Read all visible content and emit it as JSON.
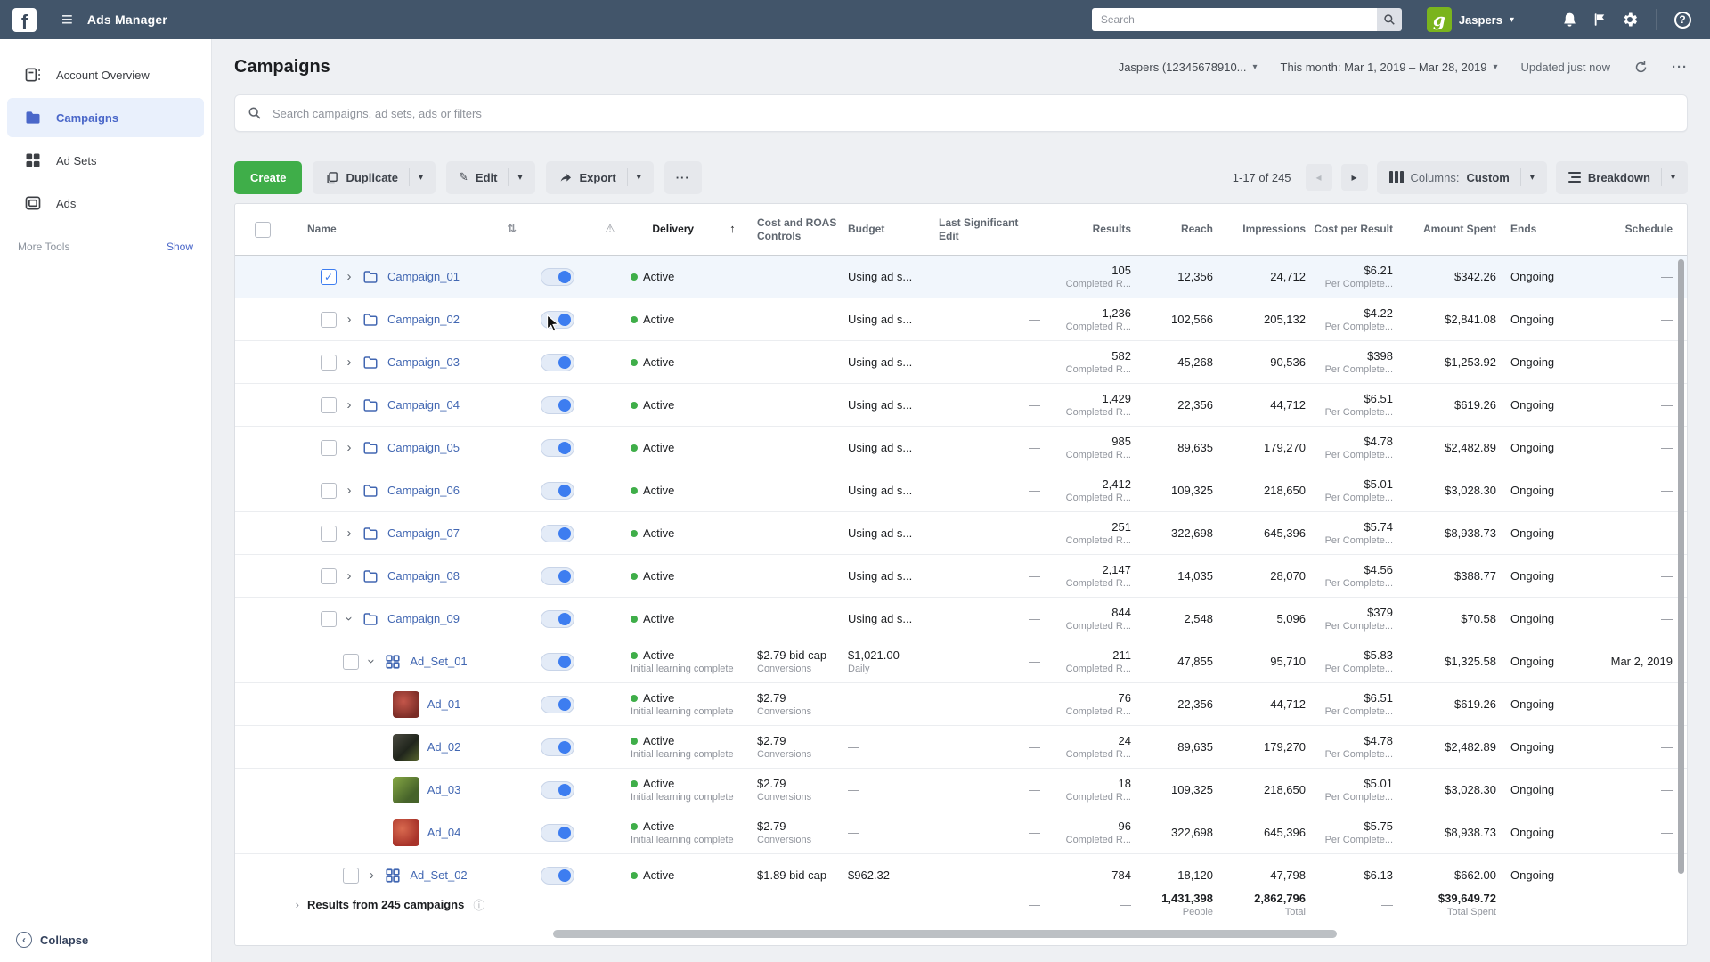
{
  "colors": {
    "topbar_bg": "#42556a",
    "accent_green": "#3fae49",
    "link_blue": "#4267b2",
    "sidebar_active_blue": "#4a67c9",
    "toggle_blue": "#3d7df0",
    "active_dot_green": "#3fae49"
  },
  "icons": {
    "facebook_letter": "f",
    "hamburger": "≡",
    "avatar_letter": "g",
    "caret": "▾",
    "question": "?",
    "sort": "⇅",
    "sort_asc": "↑",
    "warning": "⚠",
    "chevron": "›",
    "check": "✓",
    "ellipsis": "···",
    "prev": "◂",
    "next": "▸",
    "pencil": "✎",
    "info": "ⓘ",
    "collapse": "‹",
    "expander": "›"
  },
  "topbar": {
    "app_title": "Ads Manager",
    "search_placeholder": "Search",
    "user_name": "Jaspers"
  },
  "sidebar": {
    "items": [
      {
        "label": "Account Overview"
      },
      {
        "label": "Campaigns"
      },
      {
        "label": "Ad Sets"
      },
      {
        "label": "Ads"
      }
    ],
    "more_tools_label": "More Tools",
    "show_label": "Show",
    "collapse_label": "Collapse"
  },
  "header": {
    "page_title": "Campaigns",
    "account_selector": "Jaspers (12345678910...",
    "date_range": "This month: Mar 1, 2019 – Mar 28, 2019",
    "updated_label": "Updated just now"
  },
  "searchbar": {
    "placeholder": "Search campaigns, ad sets, ads or filters"
  },
  "toolbar": {
    "create_label": "Create",
    "duplicate_label": "Duplicate",
    "edit_label": "Edit",
    "export_label": "Export",
    "pagination": "1-17 of 245",
    "columns_label": "Columns:",
    "columns_value": "Custom",
    "breakdown_label": "Breakdown"
  },
  "table": {
    "headers": {
      "name": "Name",
      "delivery": "Delivery",
      "cost": "Cost and ROAS Controls",
      "budget": "Budget",
      "lse": "Last Significant Edit",
      "results": "Results",
      "reach": "Reach",
      "impressions": "Impressions",
      "cpr": "Cost per Result",
      "spent": "Amount Spent",
      "ends": "Ends",
      "schedule": "Schedule"
    },
    "rows": [
      {
        "type": "campaign",
        "name": "Campaign_01",
        "checked": true,
        "selected": true,
        "chevron": "right",
        "delivery": "Active",
        "delivery_sub": "",
        "cost": "",
        "cost_sub": "",
        "budget": "Using ad s...",
        "budget_sub": "",
        "lse": "",
        "results": "105",
        "results_sub": "Completed R...",
        "reach": "12,356",
        "impressions": "24,712",
        "cpr": "$6.21",
        "cpr_sub": "Per Complete...",
        "spent": "$342.26",
        "ends": "Ongoing",
        "schedule": "—"
      },
      {
        "type": "campaign",
        "name": "Campaign_02",
        "checked": false,
        "chevron": "right",
        "delivery": "Active",
        "delivery_sub": "",
        "cost": "",
        "cost_sub": "",
        "budget": "Using ad s...",
        "budget_sub": "",
        "lse": "—",
        "results": "1,236",
        "results_sub": "Completed R...",
        "reach": "102,566",
        "impressions": "205,132",
        "cpr": "$4.22",
        "cpr_sub": "Per Complete...",
        "spent": "$2,841.08",
        "ends": "Ongoing",
        "schedule": "—"
      },
      {
        "type": "campaign",
        "name": "Campaign_03",
        "checked": false,
        "chevron": "right",
        "delivery": "Active",
        "delivery_sub": "",
        "cost": "",
        "cost_sub": "",
        "budget": "Using ad s...",
        "budget_sub": "",
        "lse": "—",
        "results": "582",
        "results_sub": "Completed R...",
        "reach": "45,268",
        "impressions": "90,536",
        "cpr": "$398",
        "cpr_sub": "Per Complete...",
        "spent": "$1,253.92",
        "ends": "Ongoing",
        "schedule": "—"
      },
      {
        "type": "campaign",
        "name": "Campaign_04",
        "checked": false,
        "chevron": "right",
        "delivery": "Active",
        "delivery_sub": "",
        "cost": "",
        "cost_sub": "",
        "budget": "Using ad s...",
        "budget_sub": "",
        "lse": "—",
        "results": "1,429",
        "results_sub": "Completed R...",
        "reach": "22,356",
        "impressions": "44,712",
        "cpr": "$6.51",
        "cpr_sub": "Per Complete...",
        "spent": "$619.26",
        "ends": "Ongoing",
        "schedule": "—"
      },
      {
        "type": "campaign",
        "name": "Campaign_05",
        "checked": false,
        "chevron": "right",
        "delivery": "Active",
        "delivery_sub": "",
        "cost": "",
        "cost_sub": "",
        "budget": "Using ad s...",
        "budget_sub": "",
        "lse": "—",
        "results": "985",
        "results_sub": "Completed R...",
        "reach": "89,635",
        "impressions": "179,270",
        "cpr": "$4.78",
        "cpr_sub": "Per Complete...",
        "spent": "$2,482.89",
        "ends": "Ongoing",
        "schedule": "—"
      },
      {
        "type": "campaign",
        "name": "Campaign_06",
        "checked": false,
        "chevron": "right",
        "delivery": "Active",
        "delivery_sub": "",
        "cost": "",
        "cost_sub": "",
        "budget": "Using ad s...",
        "budget_sub": "",
        "lse": "—",
        "results": "2,412",
        "results_sub": "Completed R...",
        "reach": "109,325",
        "impressions": "218,650",
        "cpr": "$5.01",
        "cpr_sub": "Per Complete...",
        "spent": "$3,028.30",
        "ends": "Ongoing",
        "schedule": "—"
      },
      {
        "type": "campaign",
        "name": "Campaign_07",
        "checked": false,
        "chevron": "right",
        "delivery": "Active",
        "delivery_sub": "",
        "cost": "",
        "cost_sub": "",
        "budget": "Using ad s...",
        "budget_sub": "",
        "lse": "—",
        "results": "251",
        "results_sub": "Completed R...",
        "reach": "322,698",
        "impressions": "645,396",
        "cpr": "$5.74",
        "cpr_sub": "Per Complete...",
        "spent": "$8,938.73",
        "ends": "Ongoing",
        "schedule": "—"
      },
      {
        "type": "campaign",
        "name": "Campaign_08",
        "checked": false,
        "chevron": "right",
        "delivery": "Active",
        "delivery_sub": "",
        "cost": "",
        "cost_sub": "",
        "budget": "Using ad s...",
        "budget_sub": "",
        "lse": "—",
        "results": "2,147",
        "results_sub": "Completed R...",
        "reach": "14,035",
        "impressions": "28,070",
        "cpr": "$4.56",
        "cpr_sub": "Per Complete...",
        "spent": "$388.77",
        "ends": "Ongoing",
        "schedule": "—"
      },
      {
        "type": "campaign",
        "name": "Campaign_09",
        "checked": false,
        "chevron": "down",
        "delivery": "Active",
        "delivery_sub": "",
        "cost": "",
        "cost_sub": "",
        "budget": "Using ad s...",
        "budget_sub": "",
        "lse": "—",
        "results": "844",
        "results_sub": "Completed R...",
        "reach": "2,548",
        "impressions": "5,096",
        "cpr": "$379",
        "cpr_sub": "Per Complete...",
        "spent": "$70.58",
        "ends": "Ongoing",
        "schedule": "—"
      },
      {
        "type": "adset",
        "name": "Ad_Set_01",
        "checked": false,
        "chevron": "down",
        "delivery": "Active",
        "delivery_sub": "Initial learning complete",
        "cost": "$2.79 bid cap",
        "cost_sub": "Conversions",
        "budget": "$1,021.00",
        "budget_sub": "Daily",
        "lse": "—",
        "results": "211",
        "results_sub": "Completed R...",
        "reach": "47,855",
        "impressions": "95,710",
        "cpr": "$5.83",
        "cpr_sub": "Per Complete...",
        "spent": "$1,325.58",
        "ends": "Ongoing",
        "schedule": "Mar 2, 2019"
      },
      {
        "type": "ad",
        "name": "Ad_01",
        "thumb": "thumb-ad1",
        "delivery": "Active",
        "delivery_sub": "Initial learning complete",
        "cost": "$2.79",
        "cost_sub": "Conversions",
        "budget": "—",
        "budget_sub": "",
        "lse": "—",
        "results": "76",
        "results_sub": "Completed R...",
        "reach": "22,356",
        "impressions": "44,712",
        "cpr": "$6.51",
        "cpr_sub": "Per Complete...",
        "spent": "$619.26",
        "ends": "Ongoing",
        "schedule": "—"
      },
      {
        "type": "ad",
        "name": "Ad_02",
        "thumb": "thumb-ad2",
        "delivery": "Active",
        "delivery_sub": "Initial learning complete",
        "cost": "$2.79",
        "cost_sub": "Conversions",
        "budget": "—",
        "budget_sub": "",
        "lse": "—",
        "results": "24",
        "results_sub": "Completed R...",
        "reach": "89,635",
        "impressions": "179,270",
        "cpr": "$4.78",
        "cpr_sub": "Per Complete...",
        "spent": "$2,482.89",
        "ends": "Ongoing",
        "schedule": "—"
      },
      {
        "type": "ad",
        "name": "Ad_03",
        "thumb": "thumb-ad3",
        "delivery": "Active",
        "delivery_sub": "Initial learning complete",
        "cost": "$2.79",
        "cost_sub": "Conversions",
        "budget": "—",
        "budget_sub": "",
        "lse": "—",
        "results": "18",
        "results_sub": "Completed R...",
        "reach": "109,325",
        "impressions": "218,650",
        "cpr": "$5.01",
        "cpr_sub": "Per Complete...",
        "spent": "$3,028.30",
        "ends": "Ongoing",
        "schedule": "—"
      },
      {
        "type": "ad",
        "name": "Ad_04",
        "thumb": "thumb-ad4",
        "delivery": "Active",
        "delivery_sub": "Initial learning complete",
        "cost": "$2.79",
        "cost_sub": "Conversions",
        "budget": "—",
        "budget_sub": "",
        "lse": "—",
        "results": "96",
        "results_sub": "Completed R...",
        "reach": "322,698",
        "impressions": "645,396",
        "cpr": "$5.75",
        "cpr_sub": "Per Complete...",
        "spent": "$8,938.73",
        "ends": "Ongoing",
        "schedule": "—"
      },
      {
        "type": "adset",
        "name": "Ad_Set_02",
        "checked": false,
        "chevron": "right",
        "cut": true,
        "delivery": "Active",
        "delivery_sub": "",
        "cost": "$1.89 bid cap",
        "cost_sub": "",
        "budget": "$962.32",
        "budget_sub": "",
        "lse": "—",
        "results": "784",
        "results_sub": "",
        "reach": "18,120",
        "impressions": "47,798",
        "cpr": "$6.13",
        "cpr_sub": "",
        "spent": "$662.00",
        "ends": "Ongoing",
        "schedule": ""
      }
    ],
    "footer": {
      "label": "Results from 245 campaigns",
      "lse": "—",
      "results": "—",
      "reach": "1,431,398",
      "reach_sub": "People",
      "impressions": "2,862,796",
      "impressions_sub": "Total",
      "cpr": "—",
      "spent": "$39,649.72",
      "spent_sub": "Total Spent"
    }
  }
}
